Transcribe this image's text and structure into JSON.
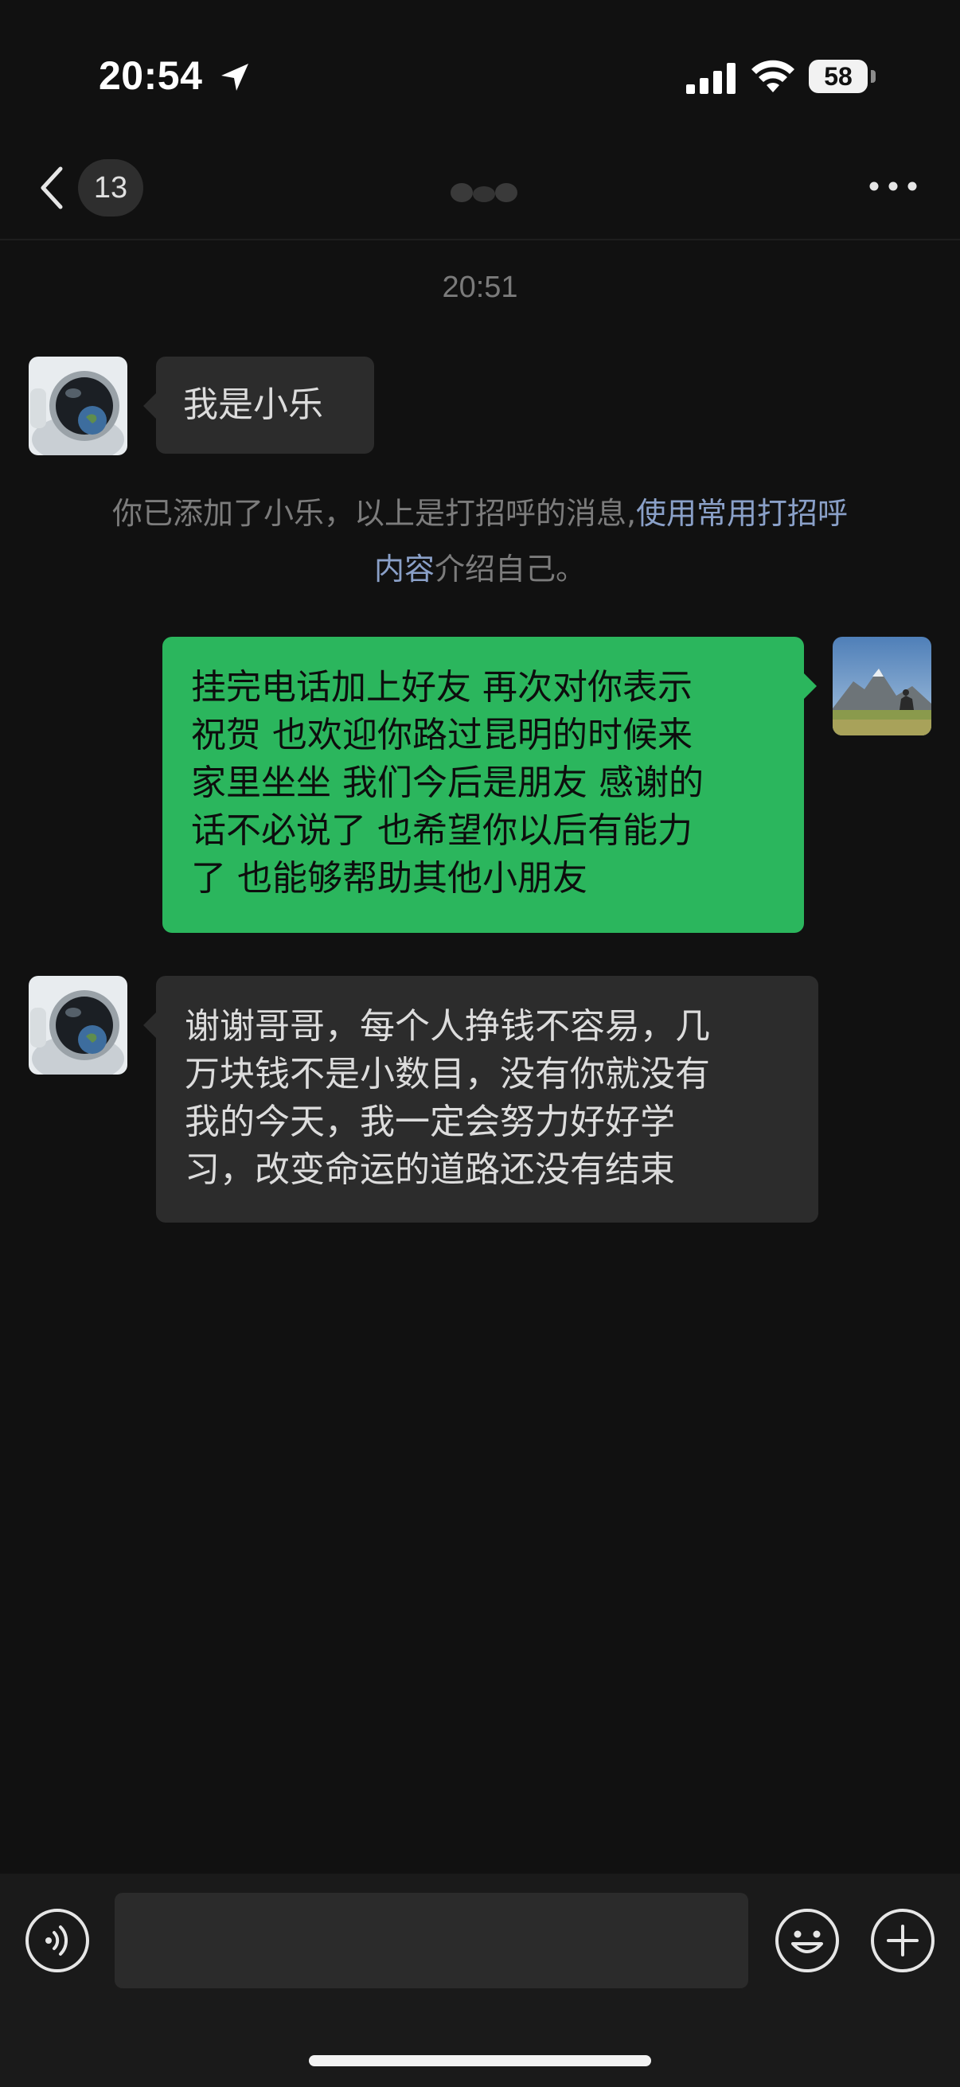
{
  "status_bar": {
    "time": "20:54",
    "battery": "58"
  },
  "nav": {
    "unread_count": "13",
    "icons": {
      "back": "chevron-left-icon",
      "more": "more-dots-icon"
    }
  },
  "chat": {
    "timestamp": "20:51",
    "messages": [
      {
        "side": "received",
        "lines": [
          "我是小乐"
        ]
      },
      {
        "side": "sent",
        "lines": [
          "挂完电话加上好友 再次对你表示",
          "祝贺 也欢迎你路过昆明的时候来",
          "家里坐坐 我们今后是朋友 感谢的",
          "话不必说了 也希望你以后有能力",
          "了 也能够帮助其他小朋友"
        ]
      },
      {
        "side": "received",
        "lines": [
          "谢谢哥哥，每个人挣钱不容易，几",
          "万块钱不是小数目，没有你就没有",
          "我的今天，我一定会努力好好学",
          "习，改变命运的道路还没有结束"
        ]
      }
    ],
    "system_note": {
      "prefix": "你已添加了小乐，以上是打招呼的消息,",
      "link_line1": "使用常用打招呼",
      "link_line2": "内容",
      "suffix": "介绍自己。"
    }
  },
  "input_bar": {
    "value": "",
    "icons": {
      "voice": "voice-icon",
      "emoji": "emoji-icon",
      "plus": "plus-icon"
    }
  },
  "colors": {
    "background": "#111111",
    "sent_bubble": "#2bb65d",
    "received_bubble": "#2c2c2c",
    "link": "#8aa0c8"
  }
}
